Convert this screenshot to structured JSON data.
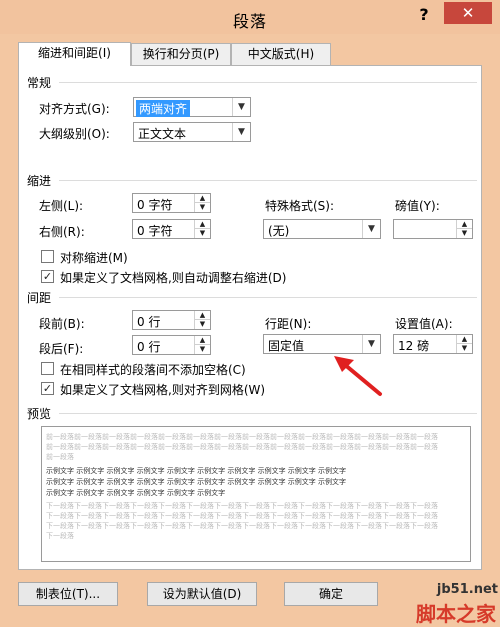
{
  "window": {
    "title": "段落",
    "help": "?",
    "close": "✕"
  },
  "tabs": [
    {
      "label": "缩进和间距(I)"
    },
    {
      "label": "换行和分页(P)"
    },
    {
      "label": "中文版式(H)"
    }
  ],
  "general": {
    "section": "常规",
    "alignment_label": "对齐方式(G):",
    "alignment_value": "两端对齐",
    "outline_label": "大纲级别(O):",
    "outline_value": "正文文本"
  },
  "indent": {
    "section": "缩进",
    "left_label": "左侧(L):",
    "left_value": "0 字符",
    "right_label": "右侧(R):",
    "right_value": "0 字符",
    "special_label": "特殊格式(S):",
    "special_value": "(无)",
    "by_label": "磅值(Y):",
    "by_value": "",
    "mirror_label": "对称缩进(M)",
    "mirror_checked": false,
    "auto_adjust_label": "如果定义了文档网格,则自动调整右缩进(D)",
    "auto_adjust_checked": true
  },
  "spacing": {
    "section": "间距",
    "before_label": "段前(B):",
    "before_value": "0 行",
    "after_label": "段后(F):",
    "after_value": "0 行",
    "line_label": "行距(N):",
    "line_value": "固定值",
    "at_label": "设置值(A):",
    "at_value": "12 磅",
    "no_space_label": "在相同样式的段落间不添加空格(C)",
    "no_space_checked": false,
    "snap_grid_label": "如果定义了文档网格,则对齐到网格(W)",
    "snap_grid_checked": true
  },
  "preview": {
    "section": "预览",
    "prev_line": "前一段落前一段落前一段落前一段落前一段落前一段落前一段落前一段落前一段落前一段落前一段落前一段落前一段落前一段落",
    "prev_line_short": "前一段落前一段落前一段落前一段落前一段落前一段落前一段落前一段落前一段落前一段落前一段落前一段落前一段落前一段落",
    "prev_line_end": "前一段落",
    "sample_line": "示例文字 示例文字 示例文字 示例文字 示例文字 示例文字 示例文字 示例文字 示例文字 示例文字",
    "sample_line_end": "示例文字 示例文字 示例文字 示例文字 示例文字 示例文字",
    "next_line": "下一段落下一段落下一段落下一段落下一段落下一段落下一段落下一段落下一段落下一段落下一段落下一段落下一段落下一段落",
    "next_line_end": "下一段落"
  },
  "buttons": {
    "tabs": "制表位(T)...",
    "default": "设为默认值(D)",
    "ok": "确定"
  },
  "watermark": {
    "site": "jb51.net",
    "name": "脚本之家"
  },
  "colors": {
    "selection": "#3399ff",
    "close": "#c7473c",
    "arrow": "#e02020"
  }
}
